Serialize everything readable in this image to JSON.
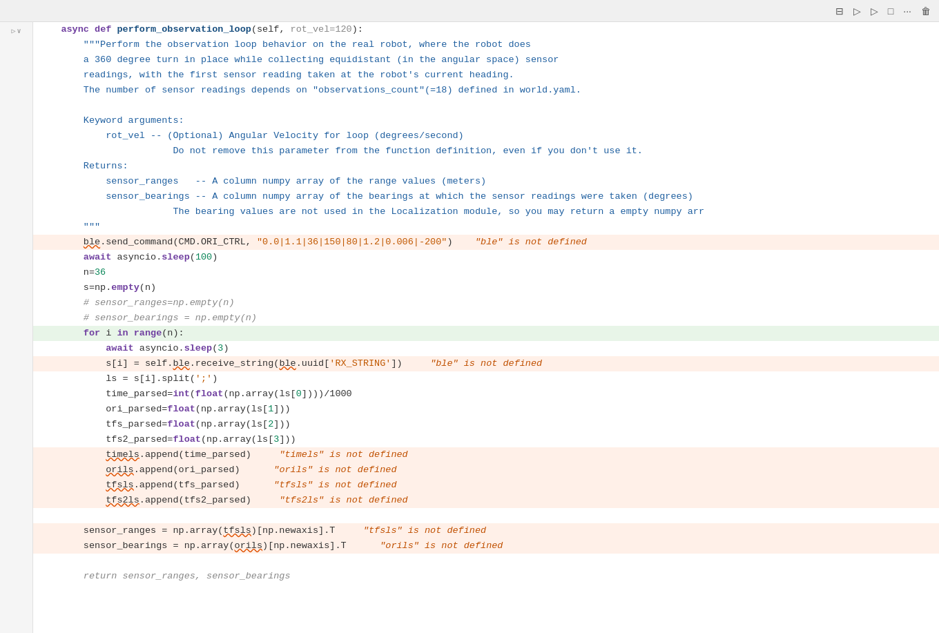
{
  "toolbar": {
    "buttons": [
      "⊟",
      "▷",
      "▷",
      "□",
      "···",
      "🗑"
    ]
  },
  "lines": [
    {
      "id": 1,
      "bg": "normal",
      "gutter_symbol": "▷",
      "content_html": "    <span class='kw-async'>async</span> <span class='kw-def'>def</span> <span class='fn-name'>perform_observation_loop</span>(<span class='var-normal'>self</span>, <span class='param-default'>rot_vel=120</span>):"
    },
    {
      "id": 2,
      "bg": "normal",
      "content_html": "        <span class='docstring'>\"\"\"Perform the observation loop behavior on the real robot, where the robot does</span>"
    },
    {
      "id": 3,
      "bg": "normal",
      "content_html": "        <span class='docstring'>a 360 degree turn in place while collecting equidistant (in the angular space) sensor</span>"
    },
    {
      "id": 4,
      "bg": "normal",
      "content_html": "        <span class='docstring'>readings, with the first sensor reading taken at the robot's current heading.</span>"
    },
    {
      "id": 5,
      "bg": "normal",
      "content_html": "        <span class='docstring'>The number of sensor readings depends on \"observations_count\"(=18) defined in world.yaml.</span>"
    },
    {
      "id": 6,
      "bg": "normal",
      "content_html": ""
    },
    {
      "id": 7,
      "bg": "normal",
      "content_html": "        <span class='docstring'>Keyword arguments:</span>"
    },
    {
      "id": 8,
      "bg": "normal",
      "content_html": "            <span class='docstring'>rot_vel -- (Optional) Angular Velocity for loop (degrees/second)</span>"
    },
    {
      "id": 9,
      "bg": "normal",
      "content_html": "                        <span class='docstring'>Do not remove this parameter from the function definition, even if you don't use it.</span>"
    },
    {
      "id": 10,
      "bg": "normal",
      "content_html": "        <span class='docstring'>Returns:</span>"
    },
    {
      "id": 11,
      "bg": "normal",
      "content_html": "            <span class='docstring'>sensor_ranges   -- A column numpy array of the range values (meters)</span>"
    },
    {
      "id": 12,
      "bg": "normal",
      "content_html": "            <span class='docstring'>sensor_bearings -- A column numpy array of the bearings at which the sensor readings were taken (degrees)</span>"
    },
    {
      "id": 13,
      "bg": "normal",
      "content_html": "                        <span class='docstring'>The bearing values are not used in the Localization module, so you may return a empty numpy arr</span>"
    },
    {
      "id": 14,
      "bg": "normal",
      "content_html": "        <span class='docstring'>\"\"\"</span>"
    },
    {
      "id": 15,
      "bg": "error",
      "content_html": "        <span class='error-underline'>ble</span>.send_command(CMD.ORI_CTRL, <span class='string'>\"0.0|1.1|36|150|80|1.2|0.006|-200\"</span>)    <span class='error-msg'>\"ble\" is not defined</span>"
    },
    {
      "id": 16,
      "bg": "normal",
      "content_html": "        <span class='kw-await'>await</span> asyncio.<span class='builtin'>sleep</span>(<span class='number'>100</span>)"
    },
    {
      "id": 17,
      "bg": "normal",
      "content_html": "        n=<span class='number'>36</span>"
    },
    {
      "id": 18,
      "bg": "normal",
      "content_html": "        s=np.<span class='builtin'>empty</span>(n)"
    },
    {
      "id": 19,
      "bg": "normal",
      "content_html": "        <span class='comment'># sensor_ranges=np.empty(n)</span>"
    },
    {
      "id": 20,
      "bg": "normal",
      "content_html": "        <span class='comment'># sensor_bearings = np.empty(n)</span>"
    },
    {
      "id": 21,
      "bg": "active",
      "content_html": "        <span class='kw-for'>for</span> i <span class='kw-in'>in</span> <span class='builtin'>range</span>(n):"
    },
    {
      "id": 22,
      "bg": "normal",
      "content_html": "            <span class='kw-await'>await</span> asyncio.<span class='builtin'>sleep</span>(<span class='number'>3</span>)"
    },
    {
      "id": 23,
      "bg": "error",
      "content_html": "            s[i] = self.<span class='error-underline'>ble</span>.receive_string(<span class='error-underline'>ble</span>.uuid[<span class='string'>'RX_STRING'</span>])     <span class='error-msg'>\"ble\" is not defined</span>"
    },
    {
      "id": 24,
      "bg": "normal",
      "content_html": "            ls = s[i].split(<span class='string'>';'</span>)"
    },
    {
      "id": 25,
      "bg": "normal",
      "content_html": "            time_parsed=<span class='builtin'>int</span>(<span class='builtin'>float</span>(np.array(ls[<span class='number'>0</span>])))/1000"
    },
    {
      "id": 26,
      "bg": "normal",
      "content_html": "            ori_parsed=<span class='builtin'>float</span>(np.array(ls[<span class='number'>1</span>]))"
    },
    {
      "id": 27,
      "bg": "normal",
      "content_html": "            tfs_parsed=<span class='builtin'>float</span>(np.array(ls[<span class='number'>2</span>]))"
    },
    {
      "id": 28,
      "bg": "normal",
      "content_html": "            tfs2_parsed=<span class='builtin'>float</span>(np.array(ls[<span class='number'>3</span>]))"
    },
    {
      "id": 29,
      "bg": "error",
      "content_html": "            <span class='error-underline'>timels</span>.append(time_parsed)     <span class='error-msg'>\"timels\" is not defined</span>"
    },
    {
      "id": 30,
      "bg": "error",
      "content_html": "            <span class='error-underline'>orils</span>.append(ori_parsed)      <span class='error-msg'>\"orils\" is not defined</span>"
    },
    {
      "id": 31,
      "bg": "error",
      "content_html": "            <span class='error-underline'>tfsls</span>.append(tfs_parsed)      <span class='error-msg'>\"tfsls\" is not defined</span>"
    },
    {
      "id": 32,
      "bg": "error",
      "content_html": "            <span class='error-underline'>tfs2ls</span>.append(tfs2_parsed)     <span class='error-msg'>\"tfs2ls\" is not defined</span>"
    },
    {
      "id": 33,
      "bg": "normal",
      "content_html": ""
    },
    {
      "id": 34,
      "bg": "error",
      "content_html": "        sensor_ranges = np.array(<span class='error-underline'>tfsls</span>)[np.newaxis].T     <span class='error-msg'>\"tfsls\" is not defined</span>"
    },
    {
      "id": 35,
      "bg": "error",
      "content_html": "        sensor_bearings = np.array(<span class='error-underline'>orils</span>)[np.newaxis].T      <span class='error-msg'>\"orils\" is not defined</span>"
    },
    {
      "id": 36,
      "bg": "normal",
      "content_html": ""
    },
    {
      "id": 37,
      "bg": "normal",
      "content_html": "        <span class='comment'>return sensor_ranges, sensor_bearings</span>"
    }
  ]
}
